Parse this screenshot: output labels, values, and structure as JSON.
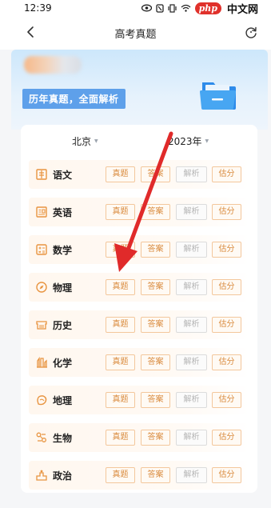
{
  "status_bar": {
    "time": "12:39",
    "icons": [
      "eye-icon",
      "nfc-icon",
      "vibrate-icon",
      "wifi-icon"
    ],
    "watermark_logo": "php",
    "watermark_text": "中文网"
  },
  "header": {
    "title": "高考真题"
  },
  "banner": {
    "slogan": "历年真题，全面解析"
  },
  "filters": {
    "region": "北京",
    "year": "2023年"
  },
  "actions": {
    "real": "真题",
    "answer": "答案",
    "analysis": "解析",
    "score": "估分"
  },
  "subjects": [
    {
      "name": "语文",
      "icon": "book-icon"
    },
    {
      "name": "英语",
      "icon": "image-text-icon"
    },
    {
      "name": "数学",
      "icon": "calculator-icon"
    },
    {
      "name": "物理",
      "icon": "compass-icon"
    },
    {
      "name": "历史",
      "icon": "scroll-icon"
    },
    {
      "name": "化学",
      "icon": "flask-icon"
    },
    {
      "name": "地理",
      "icon": "globe-icon"
    },
    {
      "name": "生物",
      "icon": "dna-icon"
    },
    {
      "name": "政治",
      "icon": "podium-icon"
    }
  ],
  "colors": {
    "accent": "#d98a3c",
    "banner_tag": "#5ea0ea",
    "arrow": "#e02a2a"
  }
}
